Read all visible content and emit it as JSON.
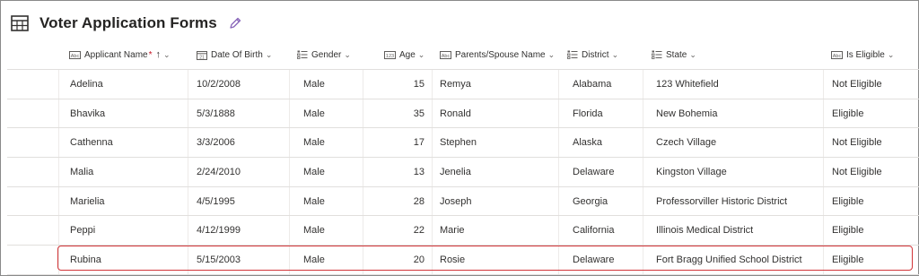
{
  "title": "Voter Application Forms",
  "columns": {
    "applicant_name": "Applicant Name",
    "date_of_birth": "Date Of Birth",
    "gender": "Gender",
    "age": "Age",
    "parents_spouse": "Parents/Spouse Name",
    "district": "District",
    "state": "State",
    "is_eligible": "Is Eligible"
  },
  "rows": [
    {
      "name": "Adelina",
      "dob": "10/2/2008",
      "gender": "Male",
      "age": "15",
      "parent": "Remya",
      "district": "Alabama",
      "state": "123 Whitefield",
      "eligible": "Not Eligible"
    },
    {
      "name": "Bhavika",
      "dob": "5/3/1888",
      "gender": "Male",
      "age": "35",
      "parent": "Ronald",
      "district": "Florida",
      "state": "New Bohemia",
      "eligible": "Eligible"
    },
    {
      "name": "Cathenna",
      "dob": "3/3/2006",
      "gender": "Male",
      "age": "17",
      "parent": "Stephen",
      "district": "Alaska",
      "state": "Czech Village",
      "eligible": "Not Eligible"
    },
    {
      "name": "Malia",
      "dob": "2/24/2010",
      "gender": "Male",
      "age": "13",
      "parent": "Jenelia",
      "district": "Delaware",
      "state": "Kingston Village",
      "eligible": "Not Eligible"
    },
    {
      "name": "Marielia",
      "dob": "4/5/1995",
      "gender": "Male",
      "age": "28",
      "parent": "Joseph",
      "district": "Georgia",
      "state": "Professorviller Historic District",
      "eligible": "Eligible"
    },
    {
      "name": "Peppi",
      "dob": "4/12/1999",
      "gender": "Male",
      "age": "22",
      "parent": "Marie",
      "district": "California",
      "state": "Illinois Medical District",
      "eligible": "Eligible"
    },
    {
      "name": "Rubina",
      "dob": "5/15/2003",
      "gender": "Male",
      "age": "20",
      "parent": "Rosie",
      "district": "Delaware",
      "state": "Fort Bragg Unified School District",
      "eligible": "Eligible"
    }
  ],
  "highlight_color": "#d13438",
  "accent_color": "#8764b8"
}
